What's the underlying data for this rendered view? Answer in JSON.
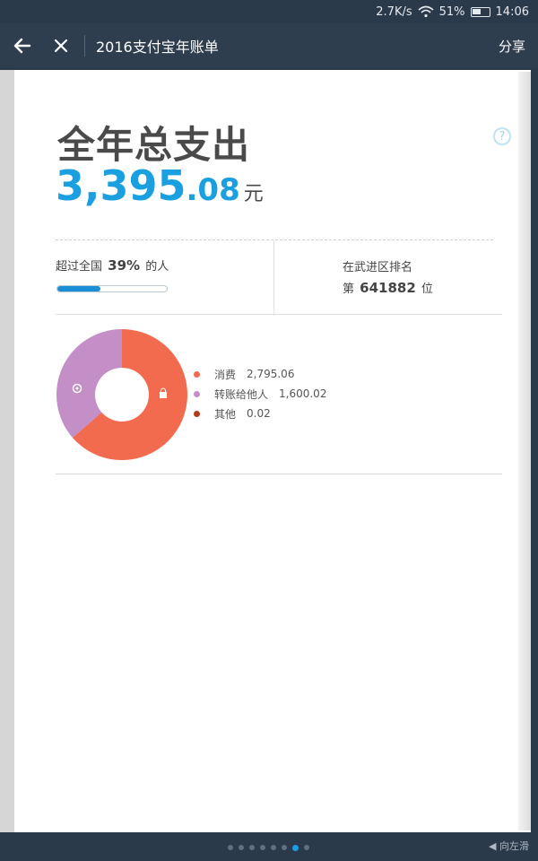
{
  "status_bar": {
    "speed": "2.7K/s",
    "battery": "51%",
    "time": "14:06"
  },
  "header": {
    "title": "2016支付宝年账单",
    "share_label": "分享"
  },
  "summary": {
    "title": "全年总支出",
    "amount_int": "3,395",
    "amount_dec": ".08",
    "unit": "元",
    "help": "?"
  },
  "stats": {
    "exceed_prefix": "超过全国",
    "exceed_value": "39%",
    "exceed_suffix": "的人",
    "exceed_progress": 0.39,
    "rank_label": "在武进区排名",
    "rank_prefix": "第",
    "rank_value": "641882",
    "rank_suffix": "位"
  },
  "chart_data": {
    "type": "pie",
    "categories": [
      "消费",
      "转账给他人",
      "其他"
    ],
    "values": [
      2795.06,
      1600.02,
      0.02
    ],
    "value_labels": [
      "2,795.06",
      "1,600.02",
      "0.02"
    ],
    "colors": [
      "#f26b4f",
      "#c48ec6",
      "#b23a1e"
    ]
  },
  "pager": {
    "count": 8,
    "active": 6
  },
  "swipe_hint": "◀ 向左滑"
}
